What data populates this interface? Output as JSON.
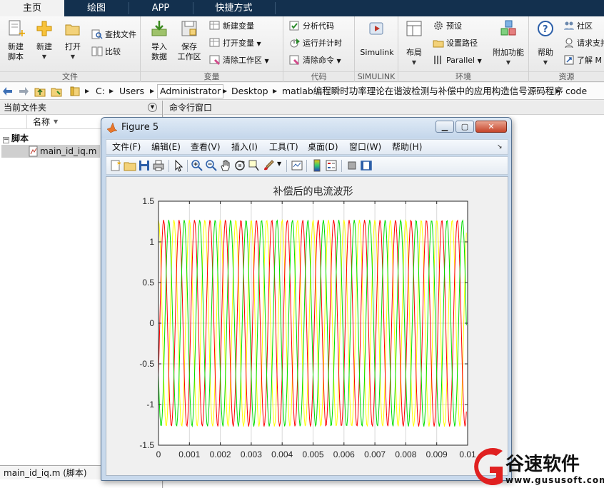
{
  "tabs": [
    {
      "label": "主页",
      "active": true
    },
    {
      "label": "绘图",
      "active": false
    },
    {
      "label": "APP",
      "active": false
    },
    {
      "label": "快捷方式",
      "active": false
    }
  ],
  "ribbon": {
    "file": {
      "group_label": "文件",
      "new_script": "新建\n脚本",
      "new_label": "新建",
      "open_label": "打开",
      "find_files": "查找文件",
      "compare": "比较"
    },
    "variable": {
      "group_label": "变量",
      "import_data": "导入\n数据",
      "save_workspace": "保存\n工作区",
      "new_variable": "新建变量",
      "open_variable": "打开变量",
      "clear_workspace": "清除工作区"
    },
    "code": {
      "group_label": "代码",
      "analyze_code": "分析代码",
      "run_and_time": "运行并计时",
      "clear_commands": "清除命令"
    },
    "simulink": {
      "group_label": "SIMULINK",
      "simulink_label": "Simulink"
    },
    "environment": {
      "group_label": "环境",
      "layout": "布局",
      "preferences": "预设",
      "set_path": "设置路径",
      "parallel": "Parallel",
      "addons": "附加功能"
    },
    "resources": {
      "group_label": "资源",
      "help": "帮助",
      "community": "社区",
      "request_support": "请求支持",
      "learn_matlab": "了解 M"
    }
  },
  "path": {
    "segments": [
      "C:",
      "Users",
      "Administrator",
      "Desktop",
      "matlab编程瞬时功率理论在谐波检测与补偿中的应用构造信号源码程序",
      "code"
    ]
  },
  "current_folder": {
    "title": "当前文件夹",
    "column_name": "名称",
    "group": "脚本",
    "file": "main_id_iq.m",
    "status": "main_id_iq.m  (脚本)"
  },
  "command_window": {
    "title": "命令行窗口"
  },
  "figure": {
    "title": "Figure 5",
    "menus": [
      "文件(F)",
      "编辑(E)",
      "查看(V)",
      "插入(I)",
      "工具(T)",
      "桌面(D)",
      "窗口(W)",
      "帮助(H)"
    ],
    "toolbar_icons": [
      "new-figure-icon",
      "open-file-icon",
      "save-icon",
      "print-icon",
      "pointer-icon",
      "zoom-in-icon",
      "zoom-out-icon",
      "pan-icon",
      "rotate-3d-icon",
      "data-cursor-icon",
      "brush-icon",
      "link-plot-icon",
      "colorbar-icon",
      "legend-icon",
      "hide-plot-tools-icon",
      "show-plot-tools-icon"
    ]
  },
  "chart_data": {
    "type": "line",
    "title": "补偿后的电流波形",
    "xlabel": "",
    "ylabel": "",
    "xlim": [
      0,
      0.01
    ],
    "ylim": [
      -1.5,
      1.5
    ],
    "x_ticks": [
      "0",
      "0.001",
      "0.002",
      "0.003",
      "0.004",
      "0.005",
      "0.006",
      "0.007",
      "0.008",
      "0.009",
      "0.01"
    ],
    "y_ticks": [
      "-1.5",
      "-1",
      "-0.5",
      "0",
      "0.5",
      "1",
      "1.5"
    ],
    "grid": true,
    "series": [
      {
        "color": "#ffff00",
        "amplitude": 1.27,
        "frequency_hz": 2000,
        "phase_deg": 90
      },
      {
        "color": "#ff0000",
        "amplitude": 1.27,
        "frequency_hz": 2000,
        "phase_deg": -30
      },
      {
        "color": "#00dd00",
        "amplitude": 1.27,
        "frequency_hz": 2000,
        "phase_deg": 210
      }
    ],
    "x_end": 0.00996
  },
  "watermark": {
    "logo_letter": "G",
    "brand": "谷速软件",
    "site": "www.gususoft.com",
    "brand_color": "#e02020"
  }
}
